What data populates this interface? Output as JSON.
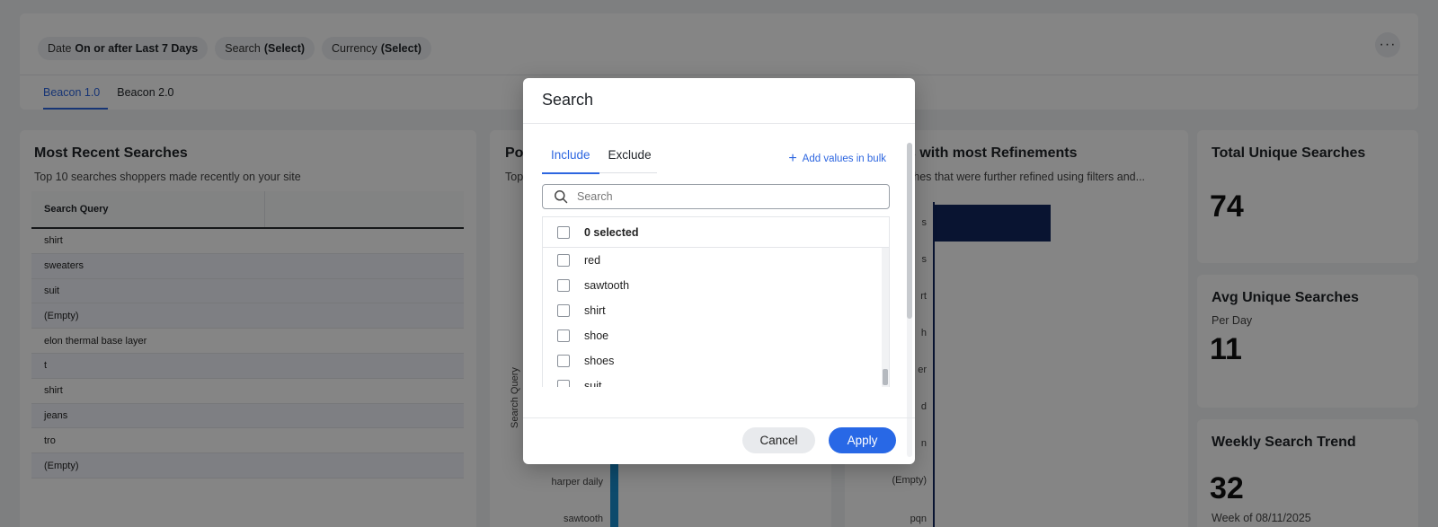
{
  "filters": {
    "chips": [
      {
        "key": "Date",
        "value": "On or after Last 7 Days"
      },
      {
        "key": "Search",
        "value": "(Select)"
      },
      {
        "key": "Currency",
        "value": "(Select)"
      }
    ],
    "more_label": "···"
  },
  "tabs": [
    {
      "label": "Beacon 1.0",
      "active": true
    },
    {
      "label": "Beacon 2.0",
      "active": false
    }
  ],
  "recent_searches": {
    "title": "Most Recent Searches",
    "subtitle": "Top 10 searches shoppers made recently on your site",
    "column_header": "Search Query",
    "rows": [
      "shirt",
      "sweaters",
      "suit",
      "(Empty)",
      "elon thermal base layer",
      "t",
      "shirt",
      "jeans",
      "tro",
      "(Empty)"
    ]
  },
  "popular_searches": {
    "title": "Po",
    "subtitle": "Top",
    "y_axis_title": "Search Query",
    "visible_categories": [
      "harper daily",
      "sawtooth"
    ]
  },
  "refinements": {
    "title": "s with most Refinements",
    "subtitle": "ches that were further refined using filters and...",
    "visible_partial_labels": [
      "s",
      "s",
      "rt",
      "h",
      "er",
      "d",
      "n",
      "(Empty)",
      "pqn"
    ]
  },
  "metrics": {
    "total_unique": {
      "title": "Total Unique Searches",
      "value": "74"
    },
    "avg_unique": {
      "title": "Avg Unique Searches",
      "subtitle": "Per Day",
      "value": "11"
    },
    "weekly_trend": {
      "title": "Weekly Search Trend",
      "value": "32",
      "footnote": "Week of 08/11/2025"
    }
  },
  "modal": {
    "title": "Search",
    "tabs": [
      {
        "label": "Include",
        "active": true
      },
      {
        "label": "Exclude",
        "active": false
      }
    ],
    "bulk_label": "Add values in bulk",
    "search_placeholder": "Search",
    "selected_label": "0 selected",
    "items": [
      "red",
      "sawtooth",
      "shirt",
      "shoe",
      "shoes",
      "suit"
    ],
    "cancel_label": "Cancel",
    "apply_label": "Apply"
  },
  "colors": {
    "accent": "#2d66e0",
    "apply_button": "#2868e6",
    "bar_navy": "#12285f",
    "bar_cyan": "#1a8fd0"
  }
}
